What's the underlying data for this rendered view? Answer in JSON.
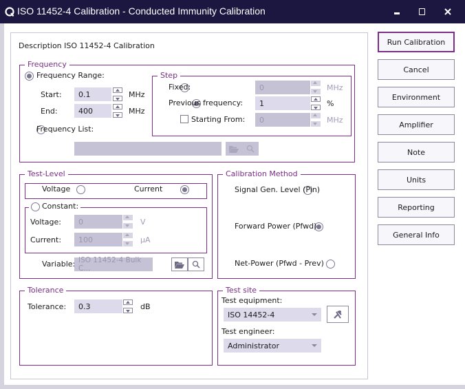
{
  "window": {
    "title": "ISO 11452-4 Calibration - Conducted Immunity Calibration",
    "icon": "app-logo-icon",
    "controls": [
      "minimize-icon",
      "maximize-icon",
      "close-icon"
    ]
  },
  "description": "Description ISO 11452-4 Calibration",
  "frequency": {
    "group_label": "Frequency",
    "range_label": "Frequency Range:",
    "range_selected": true,
    "start_label": "Start:",
    "start_value": "0.1",
    "start_unit": "MHz",
    "end_label": "End:",
    "end_value": "400",
    "end_unit": "MHz",
    "list_label": "Frequency List:",
    "list_selected": false,
    "list_value": "",
    "step": {
      "group_label": "Step",
      "fixed_label": "Fixed:",
      "fixed_value": "0",
      "fixed_unit": "MHz",
      "prev_label": "Previous frequency:",
      "prev_value": "1",
      "prev_unit": "%",
      "starting_label": "Starting From:",
      "starting_checked": false,
      "starting_value": "0",
      "starting_unit": "MHz"
    }
  },
  "test_level": {
    "group_label": "Test-Level",
    "voltage_label": "Voltage",
    "current_label": "Current",
    "selected_type": "Current",
    "constant_label": "Constant:",
    "constant_voltage_label": "Voltage:",
    "constant_voltage_value": "0",
    "constant_voltage_unit": "V",
    "constant_current_label": "Current:",
    "constant_current_value": "100",
    "constant_current_unit": "µA",
    "variable_label": "Variable:",
    "variable_value": "ISO 11452-4 Bulk C..."
  },
  "calibration_method": {
    "group_label": "Calibration Method",
    "options": [
      "Signal Gen. Level (Pin)",
      "Forward Power (Pfwd)",
      "Net-Power (Pfwd - Prev)"
    ],
    "selected": "Forward Power (Pfwd)"
  },
  "tolerance": {
    "group_label": "Tolerance",
    "label": "Tolerance:",
    "value": "0.3",
    "unit": "dB"
  },
  "test_site": {
    "group_label": "Test site",
    "equipment_label": "Test equipment:",
    "equipment_value": "ISO 14452-4",
    "engineer_label": "Test engineer:",
    "engineer_value": "Administrator"
  },
  "buttons": {
    "run": "Run Calibration",
    "cancel": "Cancel",
    "environment": "Environment",
    "amplifier": "Amplifier",
    "note": "Note",
    "units": "Units",
    "reporting": "Reporting",
    "general_info": "General Info"
  },
  "colors": {
    "titlebar": "#1c1740",
    "accent": "#7a2c86",
    "field_bg": "#dcdaeb",
    "field_disabled_bg": "#c5c2d6"
  }
}
